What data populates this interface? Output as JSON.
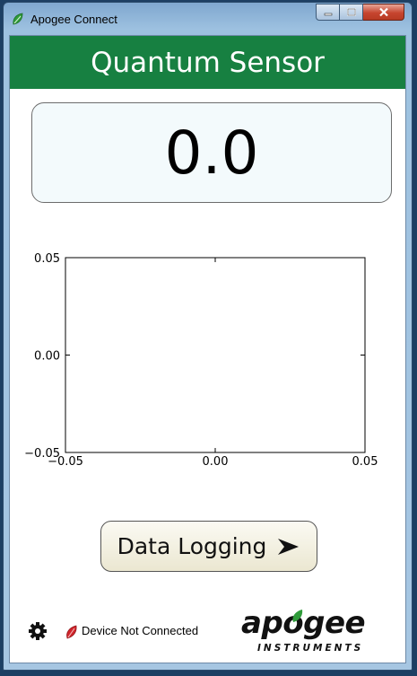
{
  "window": {
    "title": "Apogee Connect",
    "app_icon": "apogee-leaf-icon"
  },
  "caption_buttons": {
    "minimize": "minimize-icon",
    "maximize": "maximize-icon",
    "close": "close-icon"
  },
  "header": {
    "title": "Quantum Sensor"
  },
  "reading": {
    "value": "0.0"
  },
  "chart_data": {
    "type": "line",
    "series": [],
    "xlim": [
      -0.05,
      0.05
    ],
    "ylim": [
      -0.05,
      0.05
    ],
    "xticks": [
      "−0.05",
      "0.00",
      "0.05"
    ],
    "yticks": [
      "0.05",
      "0.00",
      "−0.05"
    ],
    "grid": false
  },
  "data_logging": {
    "label": "Data Logging",
    "icon": "arrow-right-icon"
  },
  "footer": {
    "settings_icon": "gear-icon",
    "status_icon": "leaf-status-icon",
    "status_text": "Device Not Connected",
    "logo_word": "apogee",
    "logo_sub": "INSTRUMENTS"
  },
  "colors": {
    "header_green": "#178041",
    "status_red": "#d0252b",
    "leaf_green": "#2f9b3a"
  }
}
